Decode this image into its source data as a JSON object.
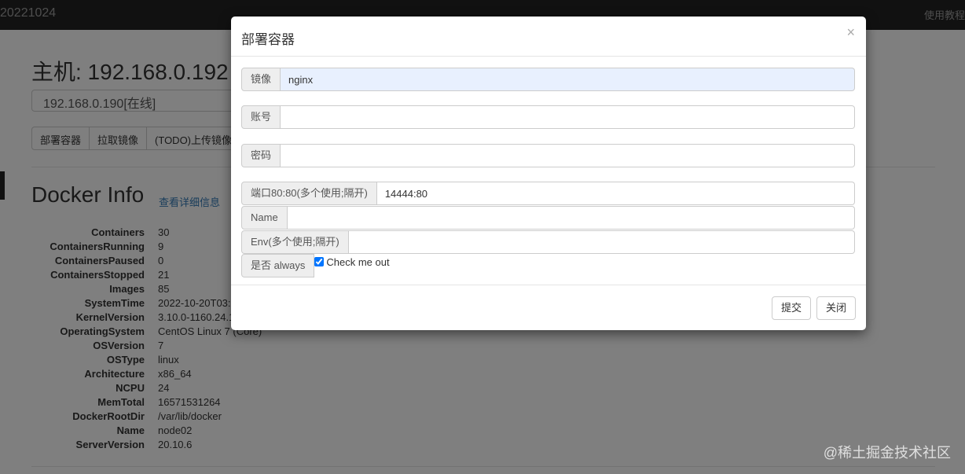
{
  "navbar": {
    "brand": "20221024",
    "help_link": "使用教程"
  },
  "host": {
    "title": "主机: 192.168.0.192",
    "selected_host": "192.168.0.190[在线]"
  },
  "toolbar": {
    "buttons": [
      "部署容器",
      "拉取镜像",
      "(TODO)上传镜像"
    ]
  },
  "docker_info": {
    "title": "Docker Info",
    "detail_link": "查看详细信息",
    "rows": [
      {
        "key": "Containers",
        "value": "30"
      },
      {
        "key": "ContainersRunning",
        "value": "9"
      },
      {
        "key": "ContainersPaused",
        "value": "0"
      },
      {
        "key": "ContainersStopped",
        "value": "21"
      },
      {
        "key": "Images",
        "value": "85"
      },
      {
        "key": "SystemTime",
        "value": "2022-10-20T03:0"
      },
      {
        "key": "KernelVersion",
        "value": "3.10.0-1160.24.1"
      },
      {
        "key": "OperatingSystem",
        "value": "CentOS Linux 7 (Core)"
      },
      {
        "key": "OSVersion",
        "value": "7"
      },
      {
        "key": "OSType",
        "value": "linux"
      },
      {
        "key": "Architecture",
        "value": "x86_64"
      },
      {
        "key": "NCPU",
        "value": "24"
      },
      {
        "key": "MemTotal",
        "value": "16571531264"
      },
      {
        "key": "DockerRootDir",
        "value": "/var/lib/docker"
      },
      {
        "key": "Name",
        "value": "node02"
      },
      {
        "key": "ServerVersion",
        "value": "20.10.6"
      }
    ]
  },
  "modal": {
    "title": "部署容器",
    "close_glyph": "×",
    "fields": {
      "image": {
        "label": "镜像",
        "value": "nginx"
      },
      "account": {
        "label": "账号",
        "value": ""
      },
      "password": {
        "label": "密码",
        "value": ""
      },
      "ports": {
        "label": "端口80:80(多个使用;隔开)",
        "value": "14444:80"
      },
      "name": {
        "label": "Name",
        "value": ""
      },
      "env": {
        "label": "Env(多个使用;隔开)",
        "value": ""
      }
    },
    "always": {
      "label": "是否 always",
      "checkbox_label": "Check me out",
      "checked": true
    },
    "submit_label": "提交",
    "close_label": "关闭"
  },
  "watermark": "@稀土掘金技术社区"
}
